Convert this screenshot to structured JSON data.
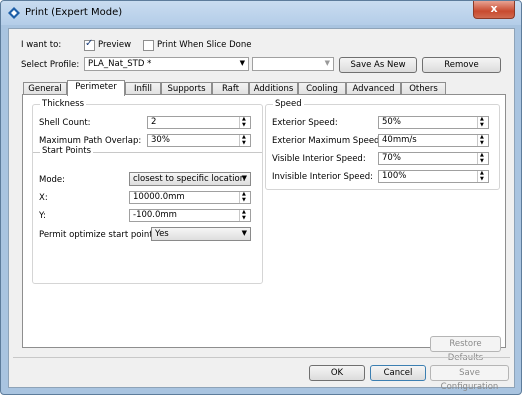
{
  "window": {
    "title": "Print (Expert Mode)",
    "close_glyph": "x"
  },
  "top": {
    "i_want_to_label": "I want to:",
    "preview_label": "Preview",
    "preview_checked": true,
    "print_when_done_label": "Print When Slice Done",
    "print_when_done_checked": false,
    "select_profile_label": "Select Profile:",
    "profile_value": "PLA_Nat_STD *",
    "second_combo_value": "",
    "save_as_new_label": "Save As New",
    "remove_label": "Remove"
  },
  "tabs": [
    "General",
    "Perimeter",
    "Infill",
    "Supports",
    "Raft",
    "Additions",
    "Cooling",
    "Advanced",
    "Others"
  ],
  "active_tab": "Perimeter",
  "thickness": {
    "title": "Thickness",
    "shell_count_label": "Shell Count:",
    "shell_count_value": "2",
    "overlap_label": "Maximum Path Overlap:",
    "overlap_value": "30%"
  },
  "start_points": {
    "title": "Start Points",
    "mode_label": "Mode:",
    "mode_value": "closest to specific location",
    "x_label": "X:",
    "x_value": "10000.0mm",
    "y_label": "Y:",
    "y_value": "-100.0mm",
    "optimize_label": "Permit optimize start points:",
    "optimize_value": "Yes"
  },
  "speed": {
    "title": "Speed",
    "exterior_label": "Exterior Speed:",
    "exterior_value": "50%",
    "exterior_max_label": "Exterior Maximum Speed:",
    "exterior_max_value": "40mm/s",
    "visible_interior_label": "Visible Interior Speed:",
    "visible_interior_value": "70%",
    "invisible_interior_label": "Invisible Interior Speed:",
    "invisible_interior_value": "100%"
  },
  "footer": {
    "restore_defaults_label": "Restore Defaults",
    "ok_label": "OK",
    "cancel_label": "Cancel",
    "save_configuration_label": "Save Configuration"
  },
  "icons": {
    "app": "printer-diamond-icon",
    "dropdown": "chevron-down-icon",
    "spin": "up-down-arrows-icon"
  }
}
